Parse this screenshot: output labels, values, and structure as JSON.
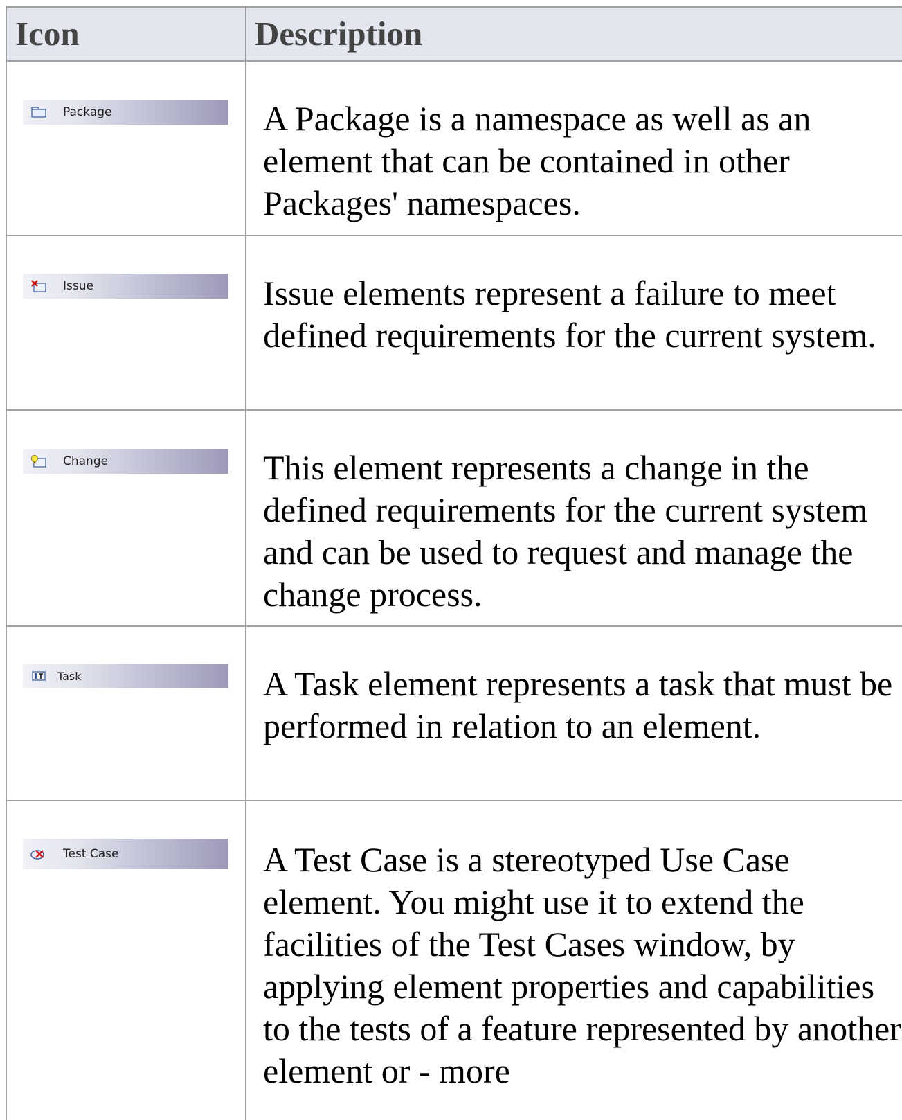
{
  "table": {
    "headers": {
      "icon": "Icon",
      "description": "Description"
    },
    "rows": [
      {
        "element_label": "Package",
        "icon": "package-icon",
        "description": "A Package is a namespace as well as an element that can be contained in other Packages' namespaces."
      },
      {
        "element_label": "Issue",
        "icon": "issue-icon",
        "description": "Issue elements represent a failure to meet defined requirements for the current system."
      },
      {
        "element_label": "Change",
        "icon": "change-icon",
        "description": "This element represents a change in the defined requirements for the current system and can be used to request and manage the change process."
      },
      {
        "element_label": "Task",
        "icon": "task-icon",
        "description": "A Task element represents a task that must be performed in relation to an element."
      },
      {
        "element_label": "Test Case",
        "icon": "test-case-icon",
        "description": "A Test Case is a stereotyped Use Case element. You might use it to extend the facilities of the Test Cases window, by applying element properties and capabilities to the tests of a feature represented by another element or - more"
      }
    ]
  }
}
